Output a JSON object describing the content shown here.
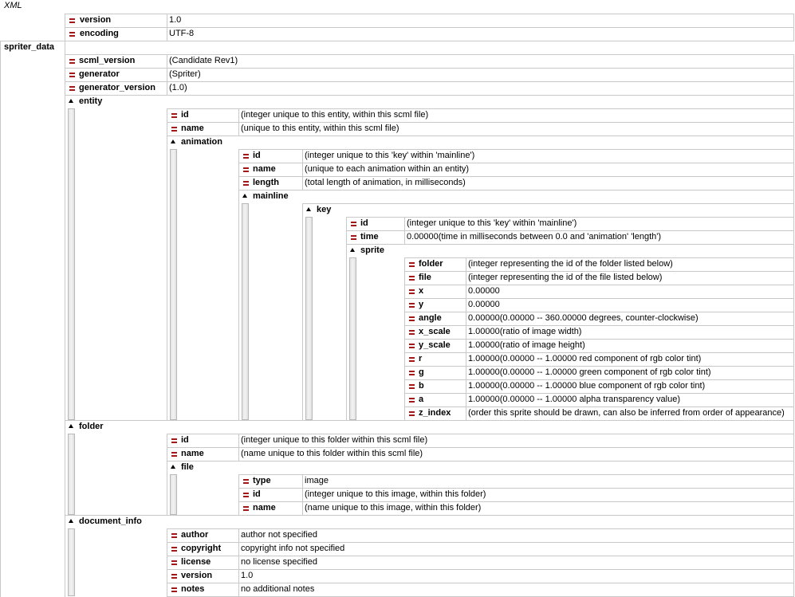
{
  "root_label": "XML",
  "xml_decl": [
    {
      "name": "version",
      "value": "1.0"
    },
    {
      "name": "encoding",
      "value": "UTF-8"
    }
  ],
  "root": {
    "name": "spriter_data",
    "attrs": [
      {
        "name": "scml_version",
        "value": "(Candidate Rev1)"
      },
      {
        "name": "generator",
        "value": "(Spriter)"
      },
      {
        "name": "generator_version",
        "value": "(1.0)"
      }
    ],
    "entity": {
      "name": "entity",
      "attrs": [
        {
          "name": "id",
          "value": "(integer unique to this entity, within this scml file)"
        },
        {
          "name": "name",
          "value": "(unique to this entity, within this scml file)"
        }
      ],
      "animation": {
        "name": "animation",
        "attrs": [
          {
            "name": "id",
            "value": "(integer unique to this 'key' within 'mainline')"
          },
          {
            "name": "name",
            "value": "(unique to each animation within an entity)"
          },
          {
            "name": "length",
            "value": "(total length of animation, in milliseconds)"
          }
        ],
        "mainline": {
          "name": "mainline",
          "key": {
            "name": "key",
            "attrs": [
              {
                "name": "id",
                "value": "(integer unique to this 'key' within 'mainline')"
              },
              {
                "name": "time",
                "value": "0.00000(time in milliseconds between 0.0 and 'animation' 'length')"
              }
            ],
            "sprite": {
              "name": "sprite",
              "attrs": [
                {
                  "name": "folder",
                  "value": "(integer representing the id of the folder listed below)"
                },
                {
                  "name": "file",
                  "value": "(integer representing the id of the file listed below)"
                },
                {
                  "name": "x",
                  "value": "0.00000"
                },
                {
                  "name": "y",
                  "value": "0.00000"
                },
                {
                  "name": "angle",
                  "value": "0.00000(0.00000 -- 360.00000 degrees, counter-clockwise)"
                },
                {
                  "name": "x_scale",
                  "value": "1.00000(ratio of image width)"
                },
                {
                  "name": "y_scale",
                  "value": "1.00000(ratio of image height)"
                },
                {
                  "name": "r",
                  "value": "1.00000(0.00000 -- 1.00000 red component of rgb color tint)"
                },
                {
                  "name": "g",
                  "value": "1.00000(0.00000 -- 1.00000 green component of rgb color tint)"
                },
                {
                  "name": "b",
                  "value": "1.00000(0.00000 -- 1.00000 blue component of rgb color tint)"
                },
                {
                  "name": "a",
                  "value": "1.00000(0.00000 -- 1.00000 alpha transparency value)"
                },
                {
                  "name": "z_index",
                  "value": "(order this sprite should be drawn, can also be inferred from order of appearance)"
                }
              ]
            }
          }
        }
      }
    },
    "folder": {
      "name": "folder",
      "attrs": [
        {
          "name": "id",
          "value": "(integer unique to this folder within this scml file)"
        },
        {
          "name": "name",
          "value": "(name unique to this folder within this scml file)"
        }
      ],
      "file": {
        "name": "file",
        "attrs": [
          {
            "name": "type",
            "value": "image"
          },
          {
            "name": "id",
            "value": "(integer unique to this image, within this folder)"
          },
          {
            "name": "name",
            "value": "(name unique to this image, within this folder)"
          }
        ]
      }
    },
    "document_info": {
      "name": "document_info",
      "attrs": [
        {
          "name": "author",
          "value": "author not specified"
        },
        {
          "name": "copyright",
          "value": "copyright info not specified"
        },
        {
          "name": "license",
          "value": "no license specified"
        },
        {
          "name": "version",
          "value": "1.0"
        },
        {
          "name": "notes",
          "value": "no additional notes"
        }
      ]
    }
  },
  "colors": {
    "attr_icon": "#a01818",
    "grid": "#c9c9c9"
  }
}
